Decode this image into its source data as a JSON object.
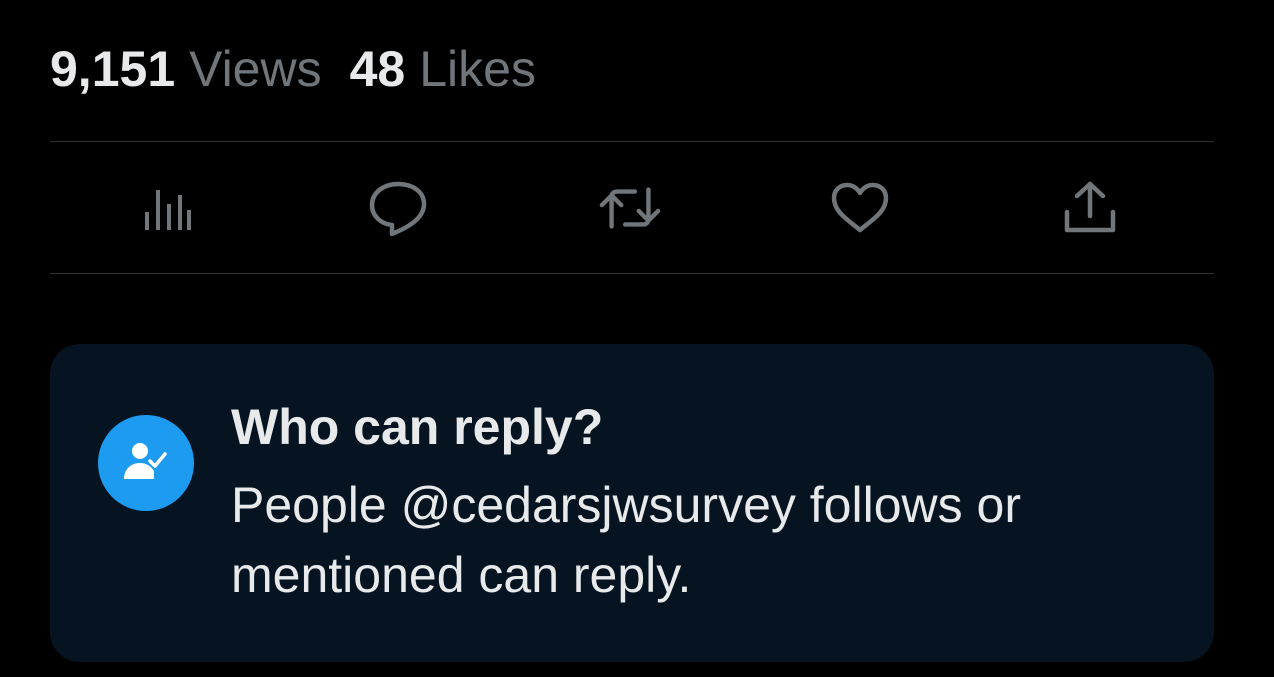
{
  "stats": {
    "views_count": "9,151",
    "views_label": "Views",
    "likes_count": "48",
    "likes_label": "Likes"
  },
  "actions": [
    {
      "name": "analytics",
      "icon": "bar-chart-icon"
    },
    {
      "name": "reply",
      "icon": "speech-bubble-icon"
    },
    {
      "name": "retweet",
      "icon": "retweet-arrows-icon"
    },
    {
      "name": "like",
      "icon": "heart-icon"
    },
    {
      "name": "share",
      "icon": "upload-share-icon"
    }
  ],
  "reply_settings": {
    "icon": "person-check-icon",
    "title": "Who can reply?",
    "description": "People @cedarsjwsurvey follows or mentioned can reply."
  },
  "colors": {
    "background": "#000000",
    "primary_text": "#e7e9ea",
    "secondary_text": "#71767b",
    "divider": "#2f3336",
    "card_background": "#061422",
    "accent_blue": "#1d9bf0"
  }
}
